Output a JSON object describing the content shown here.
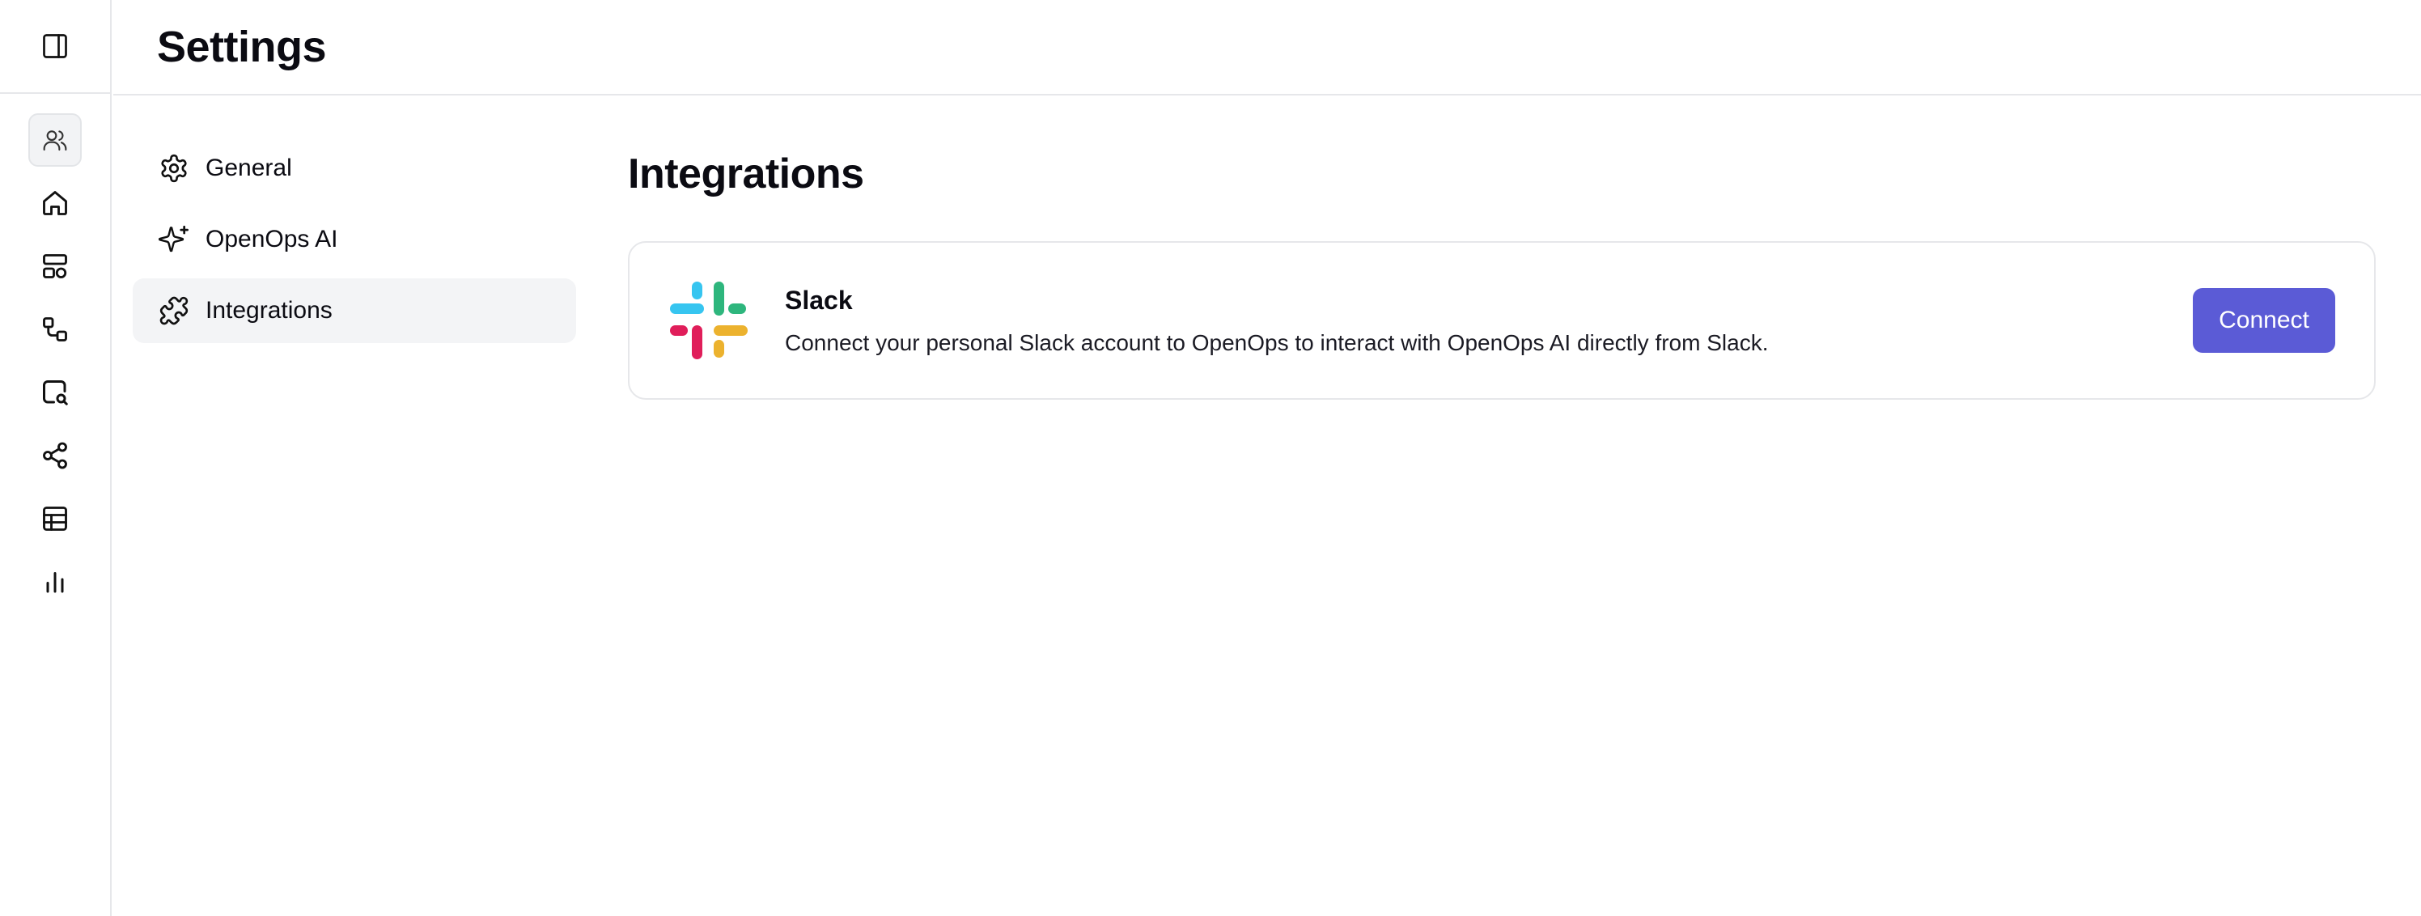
{
  "header": {
    "title": "Settings"
  },
  "rail": {
    "toggle_icon": "panel-toggle-icon",
    "items": [
      {
        "icon": "users-icon",
        "active": true
      },
      {
        "icon": "home-icon",
        "active": false
      },
      {
        "icon": "dashboard-icon",
        "active": false
      },
      {
        "icon": "workflow-icon",
        "active": false
      },
      {
        "icon": "search-doc-icon",
        "active": false
      },
      {
        "icon": "share-icon",
        "active": false
      },
      {
        "icon": "table-icon",
        "active": false
      },
      {
        "icon": "bar-chart-icon",
        "active": false
      }
    ]
  },
  "settings_nav": {
    "items": [
      {
        "label": "General",
        "icon": "gear-icon",
        "active": false
      },
      {
        "label": "OpenOps AI",
        "icon": "sparkles-icon",
        "active": false
      },
      {
        "label": "Integrations",
        "icon": "puzzle-icon",
        "active": true
      }
    ]
  },
  "main": {
    "title": "Integrations",
    "integrations": [
      {
        "name": "Slack",
        "description": "Connect your personal Slack account to OpenOps to interact with OpenOps AI directly from Slack.",
        "button_label": "Connect",
        "logo_icon": "slack-logo-icon"
      }
    ]
  },
  "colors": {
    "accent": "#5b5bd6",
    "active_bg": "#f3f4f6",
    "border": "#e6e7ea",
    "slack_blue": "#36C5F0",
    "slack_green": "#2EB67D",
    "slack_red": "#E01E5A",
    "slack_yellow": "#ECB22E"
  }
}
